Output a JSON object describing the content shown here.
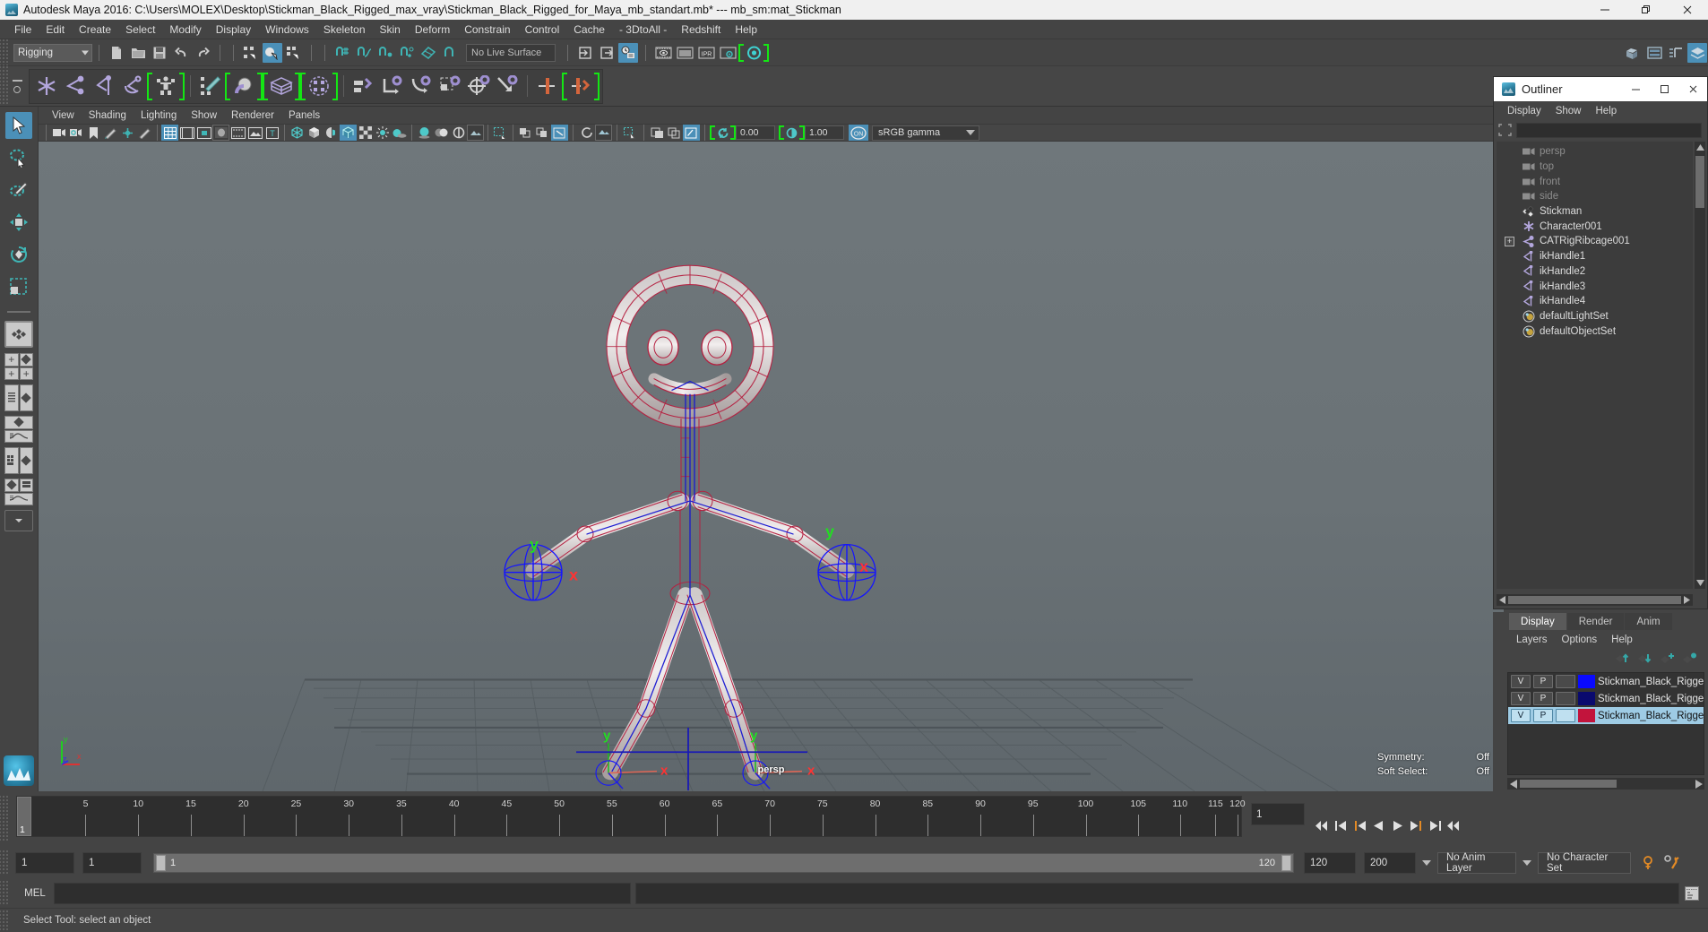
{
  "window": {
    "title": "Autodesk Maya 2016: C:\\Users\\MOLEX\\Desktop\\Stickman_Black_Rigged_max_vray\\Stickman_Black_Rigged_for_Maya_mb_standart.mb*  ---  mb_sm:mat_Stickman",
    "app_icon": "maya-icon",
    "minimize": "—",
    "restore": "❐",
    "close": "✕"
  },
  "menubar": {
    "items": [
      "File",
      "Edit",
      "Create",
      "Select",
      "Modify",
      "Display",
      "Windows",
      "Skeleton",
      "Skin",
      "Deform",
      "Constrain",
      "Control",
      "Cache",
      "- 3DtoAll -",
      "Redshift",
      "Help"
    ]
  },
  "toolbar": {
    "menu_set": "Rigging",
    "live_surface": "No Live Surface"
  },
  "viewport_menu": {
    "items": [
      "View",
      "Shading",
      "Lighting",
      "Show",
      "Renderer",
      "Panels"
    ]
  },
  "viewport_toolbar": {
    "exposure_value": "0.00",
    "gamma_value": "1.00",
    "color_space": "sRGB gamma"
  },
  "viewport": {
    "camera_label": "persp",
    "hud": [
      {
        "label": "Symmetry:",
        "value": "Off"
      },
      {
        "label": "Soft Select:",
        "value": "Off"
      }
    ],
    "axis_gizmo": {
      "x": "x",
      "y": "y",
      "z": "z"
    },
    "manipulator_labels": {
      "x": "x",
      "y": "y",
      "z": "z"
    }
  },
  "outliner": {
    "title": "Outliner",
    "menu": [
      "Display",
      "Show",
      "Help"
    ],
    "search_value": "",
    "search_placeholder": "",
    "items": [
      {
        "label": "persp",
        "icon": "camera-icon",
        "dim": true,
        "expandable": false
      },
      {
        "label": "top",
        "icon": "camera-icon",
        "dim": true,
        "expandable": false
      },
      {
        "label": "front",
        "icon": "camera-icon",
        "dim": true,
        "expandable": false
      },
      {
        "label": "side",
        "icon": "camera-icon",
        "dim": true,
        "expandable": false
      },
      {
        "label": "Stickman",
        "icon": "mesh-icon",
        "dim": false,
        "expandable": false
      },
      {
        "label": "Character001",
        "icon": "joint-star-icon",
        "dim": false,
        "expandable": false
      },
      {
        "label": "CATRigRibcage001",
        "icon": "bone-icon",
        "dim": false,
        "expandable": true
      },
      {
        "label": "ikHandle1",
        "icon": "ikhandle-icon",
        "dim": false,
        "expandable": false
      },
      {
        "label": "ikHandle2",
        "icon": "ikhandle-icon",
        "dim": false,
        "expandable": false
      },
      {
        "label": "ikHandle3",
        "icon": "ikhandle-icon",
        "dim": false,
        "expandable": false
      },
      {
        "label": "ikHandle4",
        "icon": "ikhandle-icon",
        "dim": false,
        "expandable": false
      },
      {
        "label": "defaultLightSet",
        "icon": "set-icon",
        "dim": false,
        "expandable": false
      },
      {
        "label": "defaultObjectSet",
        "icon": "set-icon",
        "dim": false,
        "expandable": false
      }
    ],
    "expand_glyph": "+"
  },
  "layer_editor": {
    "tabs": [
      {
        "label": "Display",
        "active": true
      },
      {
        "label": "Render",
        "active": false
      },
      {
        "label": "Anim",
        "active": false
      }
    ],
    "menu": [
      "Layers",
      "Options",
      "Help"
    ],
    "rows": [
      {
        "v": "V",
        "p": "P",
        "third": "",
        "color": "#0a0aff",
        "name": "Stickman_Black_Rigge",
        "selected": false
      },
      {
        "v": "V",
        "p": "P",
        "third": "",
        "color": "#0a0a6e",
        "name": "Stickman_Black_Rigge",
        "selected": false
      },
      {
        "v": "V",
        "p": "P",
        "third": "",
        "color": "#c2143c",
        "name": "Stickman_Black_Rigge",
        "selected": true
      }
    ]
  },
  "timeline": {
    "start_visible": "1",
    "ticks": [
      5,
      10,
      15,
      20,
      25,
      30,
      35,
      40,
      45,
      50,
      55,
      60,
      65,
      70,
      75,
      80,
      85,
      90,
      95,
      100,
      105,
      110,
      115,
      120
    ],
    "current_frame_marker": "1",
    "current_frame_field": "1"
  },
  "range": {
    "anim_start": "1",
    "range_start": "1",
    "slider_min_label": "1",
    "slider_max_label": "120",
    "range_end": "120",
    "anim_end": "200",
    "anim_layer": "No Anim Layer",
    "character_set": "No Character Set"
  },
  "command_line": {
    "language": "MEL",
    "input_value": "",
    "output_value": ""
  },
  "status_bar": {
    "message": "Select Tool: select an object"
  },
  "colors": {
    "accent_blue": "#4b90b8",
    "green_bracket": "#14e614",
    "panel_bg": "#444444",
    "viewport_top": "#6d7579",
    "selected_row": "#9ecbe4",
    "rig_red": "#c2143c",
    "rig_blue": "#0a0aff"
  }
}
